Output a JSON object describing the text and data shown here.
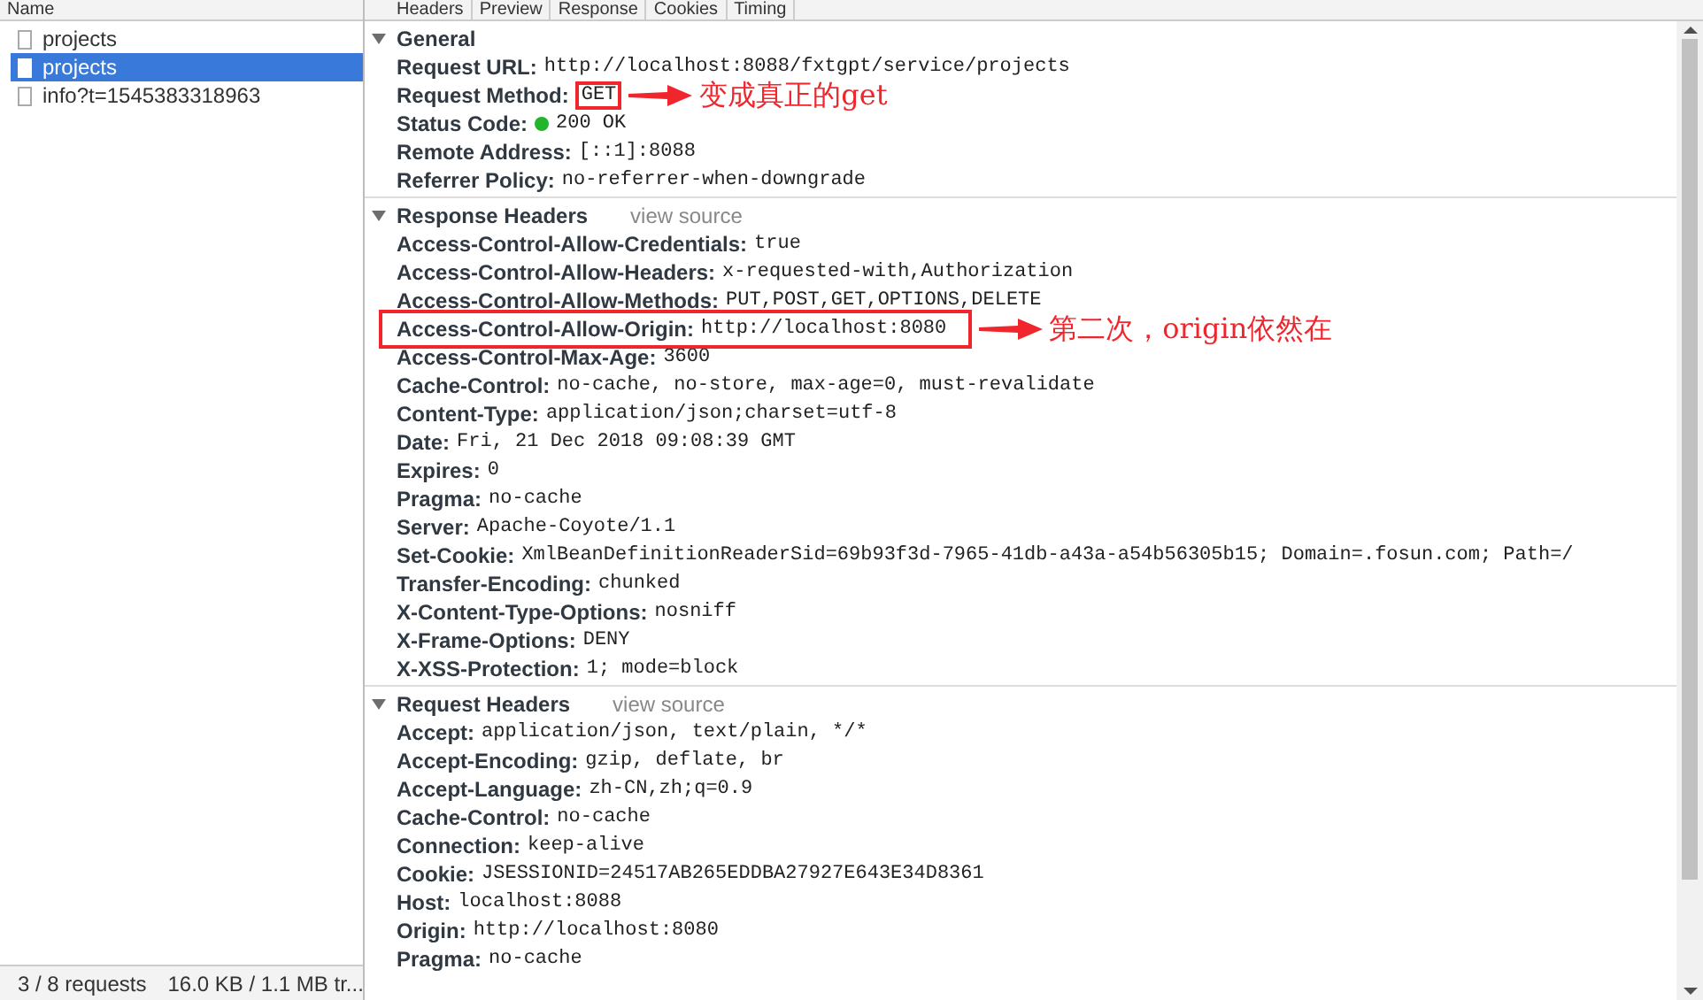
{
  "name_header": "Name",
  "tabs": [
    "Headers",
    "Preview",
    "Response",
    "Cookies",
    "Timing"
  ],
  "requests": [
    {
      "name": "projects",
      "selected": false
    },
    {
      "name": "projects",
      "selected": true
    },
    {
      "name": "info?t=1545383318963",
      "selected": false
    }
  ],
  "status_bar": {
    "requests": "3 / 8 requests",
    "transferred": "16.0 KB / 1.1 MB tr..."
  },
  "sections": [
    {
      "title": "General",
      "expanded": true,
      "rows": [
        {
          "kind": "plain",
          "key": "Request URL:",
          "value": "http://localhost:8088/fxtgpt/service/projects"
        },
        {
          "kind": "plain",
          "key": "Request Method:",
          "value": "GET",
          "annotation": {
            "whole_row": false,
            "note": "变成真正的get"
          }
        },
        {
          "kind": "status",
          "key": "Status Code:",
          "value": "200 OK"
        },
        {
          "kind": "plain",
          "key": "Remote Address:",
          "value": "[::1]:8088"
        },
        {
          "kind": "plain",
          "key": "Referrer Policy:",
          "value": "no-referrer-when-downgrade"
        }
      ]
    },
    {
      "title": "Response Headers",
      "expanded": true,
      "link": "view source",
      "rows": [
        {
          "kind": "plain",
          "key": "Access-Control-Allow-Credentials:",
          "value": "true"
        },
        {
          "kind": "plain",
          "key": "Access-Control-Allow-Headers:",
          "value": "x-requested-with,Authorization"
        },
        {
          "kind": "plain",
          "key": "Access-Control-Allow-Methods:",
          "value": "PUT,POST,GET,OPTIONS,DELETE"
        },
        {
          "kind": "plain",
          "key": "Access-Control-Allow-Origin:",
          "value": "http://localhost:8080",
          "annotation": {
            "whole_row": true,
            "note": "第二次，origin依然在"
          }
        },
        {
          "kind": "plain",
          "key": "Access-Control-Max-Age:",
          "value": "3600"
        },
        {
          "kind": "plain",
          "key": "Cache-Control:",
          "value": "no-cache, no-store, max-age=0, must-revalidate"
        },
        {
          "kind": "plain",
          "key": "Content-Type:",
          "value": "application/json;charset=utf-8"
        },
        {
          "kind": "plain",
          "key": "Date:",
          "value": "Fri, 21 Dec 2018 09:08:39 GMT"
        },
        {
          "kind": "plain",
          "key": "Expires:",
          "value": "0"
        },
        {
          "kind": "plain",
          "key": "Pragma:",
          "value": "no-cache"
        },
        {
          "kind": "plain",
          "key": "Server:",
          "value": "Apache-Coyote/1.1"
        },
        {
          "kind": "plain",
          "key": "Set-Cookie:",
          "value": "XmlBeanDefinitionReaderSid=69b93f3d-7965-41db-a43a-a54b56305b15; Domain=.fosun.com; Path=/"
        },
        {
          "kind": "plain",
          "key": "Transfer-Encoding:",
          "value": "chunked"
        },
        {
          "kind": "plain",
          "key": "X-Content-Type-Options:",
          "value": "nosniff"
        },
        {
          "kind": "plain",
          "key": "X-Frame-Options:",
          "value": "DENY"
        },
        {
          "kind": "plain",
          "key": "X-XSS-Protection:",
          "value": "1; mode=block"
        }
      ]
    },
    {
      "title": "Request Headers",
      "expanded": true,
      "link": "view source",
      "rows": [
        {
          "kind": "plain",
          "key": "Accept:",
          "value": "application/json, text/plain, */*"
        },
        {
          "kind": "plain",
          "key": "Accept-Encoding:",
          "value": "gzip, deflate, br"
        },
        {
          "kind": "plain",
          "key": "Accept-Language:",
          "value": "zh-CN,zh;q=0.9"
        },
        {
          "kind": "plain",
          "key": "Cache-Control:",
          "value": "no-cache"
        },
        {
          "kind": "plain",
          "key": "Connection:",
          "value": "keep-alive"
        },
        {
          "kind": "plain",
          "key": "Cookie:",
          "value": "JSESSIONID=24517AB265EDDBA27927E643E34D8361"
        },
        {
          "kind": "plain",
          "key": "Host:",
          "value": "localhost:8088"
        },
        {
          "kind": "plain",
          "key": "Origin:",
          "value": "http://localhost:8080"
        },
        {
          "kind": "plain",
          "key": "Pragma:",
          "value": "no-cache"
        }
      ]
    }
  ]
}
